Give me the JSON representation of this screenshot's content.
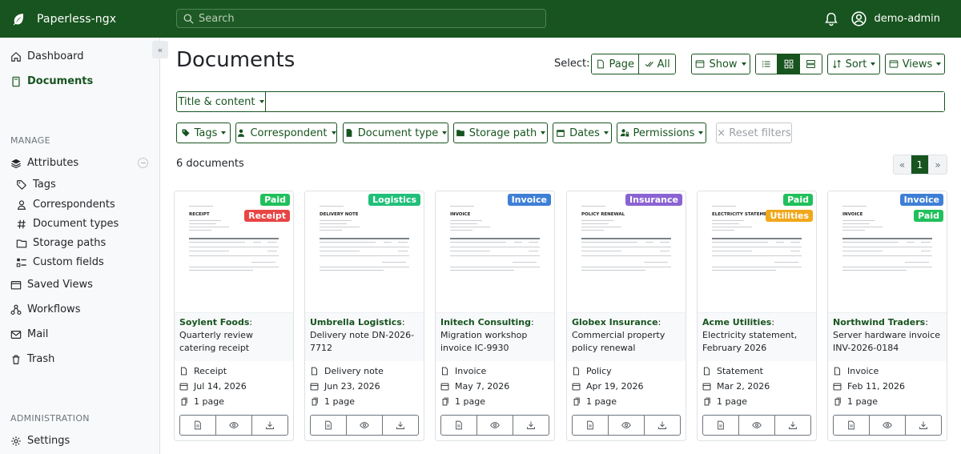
{
  "app": {
    "name": "Paperless-ngx"
  },
  "search": {
    "placeholder": "Search"
  },
  "user": {
    "name": "demo-admin"
  },
  "sidebar": {
    "collapse_glyph": "«",
    "dashboard": "Dashboard",
    "documents": "Documents",
    "manage_heading": "MANAGE",
    "attributes": "Attributes",
    "tags": "Tags",
    "correspondents": "Correspondents",
    "document_types": "Document types",
    "storage_paths": "Storage paths",
    "custom_fields": "Custom fields",
    "saved_views": "Saved Views",
    "workflows": "Workflows",
    "mail": "Mail",
    "trash": "Trash",
    "admin_heading": "ADMINISTRATION",
    "settings": "Settings"
  },
  "page": {
    "title": "Documents"
  },
  "toolbar": {
    "select_label": "Select:",
    "page_btn": "Page",
    "all_btn": "All",
    "show_btn": "Show",
    "sort_btn": "Sort",
    "views_btn": "Views",
    "active_view": "small-cards"
  },
  "filters": {
    "title_content": "Title & content",
    "query_value": "",
    "tags": "Tags",
    "correspondent": "Correspondent",
    "document_type": "Document type",
    "storage_path": "Storage path",
    "dates": "Dates",
    "permissions": "Permissions",
    "reset": "× Reset filters"
  },
  "results": {
    "count_text": "6 documents"
  },
  "pagination": {
    "prev": "«",
    "current": "1",
    "next": "»"
  },
  "colors": {
    "primary": "#17541f",
    "paid": "#20c05c",
    "receipt": "#e84545",
    "logistics": "#20c07a",
    "invoice": "#3e7fd6",
    "insurance": "#8a63d2",
    "utilities": "#f0a81b"
  },
  "documents": [
    {
      "correspondent": "Soylent Foods",
      "title": "Quarterly review catering receipt",
      "thumb_heading": "RECEIPT",
      "type": "Receipt",
      "date": "Jul 14, 2026",
      "pages": "1 page",
      "tags": [
        {
          "label": "Paid",
          "color": "#20c05c"
        },
        {
          "label": "Receipt",
          "color": "#e84545"
        }
      ]
    },
    {
      "correspondent": "Umbrella Logistics",
      "title": "Delivery note DN-2026-7712",
      "thumb_heading": "DELIVERY NOTE",
      "type": "Delivery note",
      "date": "Jun 23, 2026",
      "pages": "1 page",
      "tags": [
        {
          "label": "Logistics",
          "color": "#20c07a"
        }
      ]
    },
    {
      "correspondent": "Initech Consulting",
      "title": "Migration workshop invoice IC-9930",
      "thumb_heading": "INVOICE",
      "type": "Invoice",
      "date": "May 7, 2026",
      "pages": "1 page",
      "tags": [
        {
          "label": "Invoice",
          "color": "#3e7fd6"
        }
      ]
    },
    {
      "correspondent": "Globex Insurance",
      "title": "Commercial property policy renewal",
      "thumb_heading": "POLICY RENEWAL",
      "type": "Policy",
      "date": "Apr 19, 2026",
      "pages": "1 page",
      "tags": [
        {
          "label": "Insurance",
          "color": "#8a63d2"
        }
      ]
    },
    {
      "correspondent": "Acme Utilities",
      "title": "Electricity statement, February 2026",
      "thumb_heading": "ELECTRICITY STATEMENT",
      "type": "Statement",
      "date": "Mar 2, 2026",
      "pages": "1 page",
      "tags": [
        {
          "label": "Paid",
          "color": "#20c05c"
        },
        {
          "label": "Utilities",
          "color": "#f0a81b"
        }
      ]
    },
    {
      "correspondent": "Northwind Traders",
      "title": "Server hardware invoice INV-2026-0184",
      "thumb_heading": "INVOICE",
      "type": "Invoice",
      "date": "Feb 11, 2026",
      "pages": "1 page",
      "tags": [
        {
          "label": "Invoice",
          "color": "#3e7fd6"
        },
        {
          "label": "Paid",
          "color": "#20c05c"
        }
      ]
    }
  ]
}
